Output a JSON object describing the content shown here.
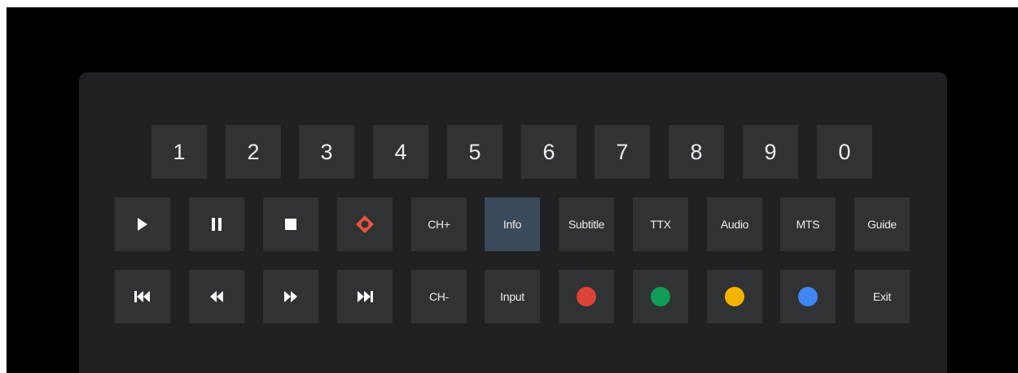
{
  "digits": [
    "1",
    "2",
    "3",
    "4",
    "5",
    "6",
    "7",
    "8",
    "9",
    "0"
  ],
  "row2": {
    "ch_plus": "CH+",
    "info": "Info",
    "subtitle": "Subtitle",
    "ttx": "TTX",
    "audio": "Audio",
    "mts": "MTS",
    "guide": "Guide"
  },
  "row3": {
    "ch_minus": "CH-",
    "input": "Input",
    "exit": "Exit"
  },
  "icons": [
    "play-icon",
    "pause-icon",
    "stop-icon",
    "record-icon",
    "skip-previous-icon",
    "rewind-icon",
    "fast-forward-icon",
    "skip-next-icon"
  ],
  "selected_key": "Info",
  "colors": {
    "red": "#db4437",
    "green": "#0f9d58",
    "yellow": "#f4b400",
    "blue": "#4285f4",
    "record_accent": "#e8533f",
    "selected_key_bg": "#3b4a5a"
  }
}
